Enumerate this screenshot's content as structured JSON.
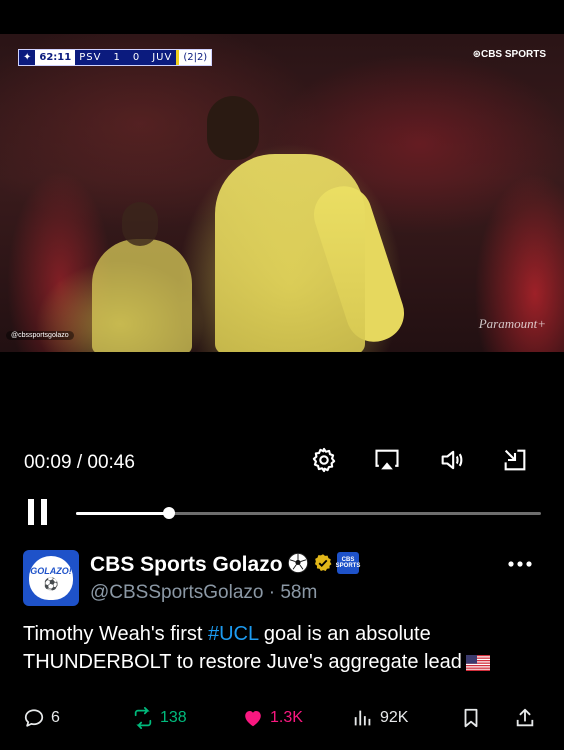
{
  "video": {
    "scorebug": {
      "clock": "62:11",
      "home_team": "PSV",
      "home_score": "1",
      "away_score": "0",
      "away_team": "JUV",
      "aggregate": "(2|2)"
    },
    "broadcaster": "⊛CBS SPORTS",
    "watermark_handle": "@cbssportsgolazo",
    "stream_watermark": "Paramount+"
  },
  "player": {
    "current_time": "00:09",
    "duration": "00:46",
    "time_separator": " / ",
    "progress_fraction": 0.2,
    "icons": [
      "gear-icon",
      "airplay-icon",
      "volume-icon",
      "minimize-icon",
      "pause-icon"
    ]
  },
  "tweet": {
    "author_name": "CBS Sports Golazo",
    "handle": "@CBSSportsGolazo",
    "separator": " · ",
    "time_ago": "58m",
    "avatar_text": "GOLAZO!",
    "affiliate_badge": "CBS SPORTS",
    "text_before": "Timothy Weah's first ",
    "hashtag": "#UCL",
    "text_after": " goal is an absolute THUNDERBOLT to restore Juve's aggregate lead",
    "flag": "us-flag"
  },
  "actions": {
    "replies": "6",
    "reposts": "138",
    "likes": "1.3K",
    "views": "92K"
  },
  "colors": {
    "background": "#000000",
    "accent_blue": "#1d9bf0",
    "repost_green": "#00ba7c",
    "like_pink": "#f91880",
    "secondary_text": "#8b98a5",
    "verified_gold": "#e2b719"
  }
}
